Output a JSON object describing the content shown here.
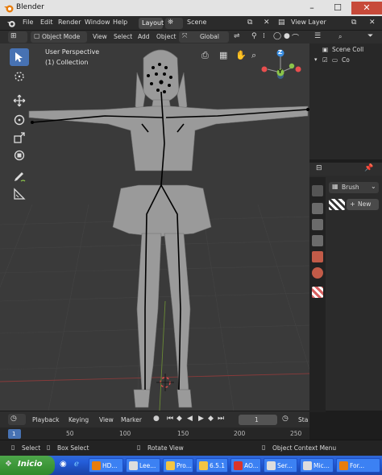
{
  "window": {
    "title": "Blender"
  },
  "menubar": {
    "items": [
      "File",
      "Edit",
      "Render",
      "Window",
      "Help"
    ],
    "workspace_tab": "Layout",
    "scene_label": "Scene",
    "view_layer_label": "View Layer"
  },
  "viewport_header": {
    "mode": "Object Mode",
    "menus": [
      "View",
      "Select",
      "Add",
      "Object"
    ],
    "transform_orientation": "Global"
  },
  "viewport": {
    "perspective_label": "User Perspective",
    "collection_label": "(1) Collection",
    "gizmo": {
      "z": "Z",
      "y": "Y"
    }
  },
  "outliner": {
    "items": [
      {
        "label": "Scene Coll"
      },
      {
        "label": "Co"
      }
    ]
  },
  "properties": {
    "brush_label": "Brush",
    "new_button": "New"
  },
  "timeline": {
    "playback": "Playback",
    "keying": "Keying",
    "view": "View",
    "marker": "Marker",
    "current_frame": "1",
    "start_label": "Sta",
    "ruler_ticks": [
      "1",
      "50",
      "100",
      "150",
      "200",
      "250"
    ]
  },
  "statusbar": {
    "items": [
      "Select",
      "Box Select",
      "Rotate View",
      "Object Context Menu"
    ]
  },
  "taskbar": {
    "start_label": "Inicio",
    "tasks": [
      "HD...",
      "Lee...",
      "Pro...",
      "6.5.1",
      "AO...",
      "Ser...",
      "Mic...",
      "For..."
    ]
  },
  "colors": {
    "accent": "#4772b3",
    "axis_x": "#e94e4e",
    "axis_y": "#8bc34a",
    "axis_z": "#3b8fe3"
  }
}
